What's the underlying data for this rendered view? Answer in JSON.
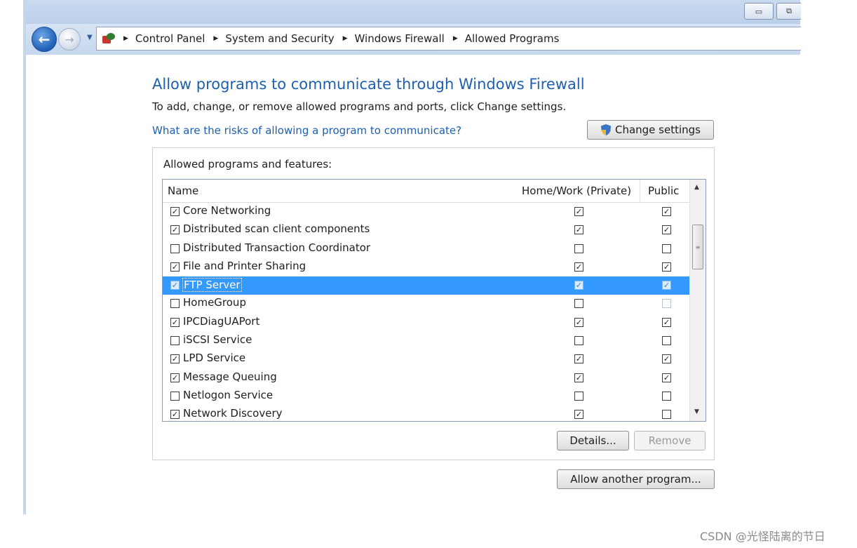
{
  "window": {
    "minimize_glyph": "▭",
    "maximize_glyph": "⧉"
  },
  "breadcrumb": {
    "items": [
      "Control Panel",
      "System and Security",
      "Windows Firewall",
      "Allowed Programs"
    ]
  },
  "main": {
    "heading": "Allow programs to communicate through Windows Firewall",
    "subtext": "To add, change, or remove allowed programs and ports, click Change settings.",
    "risk_link": "What are the risks of allowing a program to communicate?",
    "change_settings": "Change settings",
    "group_label": "Allowed programs and features:",
    "columns": {
      "name": "Name",
      "private": "Home/Work (Private)",
      "public": "Public"
    },
    "programs": [
      {
        "name": "Core Networking",
        "enabled": true,
        "private": true,
        "public": true
      },
      {
        "name": "Distributed scan client components",
        "enabled": true,
        "private": true,
        "public": true
      },
      {
        "name": "Distributed Transaction Coordinator",
        "enabled": false,
        "private": false,
        "public": false
      },
      {
        "name": "File and Printer Sharing",
        "enabled": true,
        "private": true,
        "public": true
      },
      {
        "name": "FTP Server",
        "enabled": true,
        "private": true,
        "public": true,
        "selected": true
      },
      {
        "name": "HomeGroup",
        "enabled": false,
        "private": false,
        "public": false,
        "public_disabled": true
      },
      {
        "name": "IPCDiagUAPort",
        "enabled": true,
        "private": true,
        "public": true
      },
      {
        "name": "iSCSI Service",
        "enabled": false,
        "private": false,
        "public": false
      },
      {
        "name": "LPD Service",
        "enabled": true,
        "private": true,
        "public": true
      },
      {
        "name": "Message Queuing",
        "enabled": true,
        "private": true,
        "public": true
      },
      {
        "name": "Netlogon Service",
        "enabled": false,
        "private": false,
        "public": false
      },
      {
        "name": "Network Discovery",
        "enabled": true,
        "private": true,
        "public": false
      }
    ],
    "details": "Details...",
    "remove": "Remove",
    "allow_another": "Allow another program..."
  },
  "watermark": "CSDN @光怪陆离的节日"
}
